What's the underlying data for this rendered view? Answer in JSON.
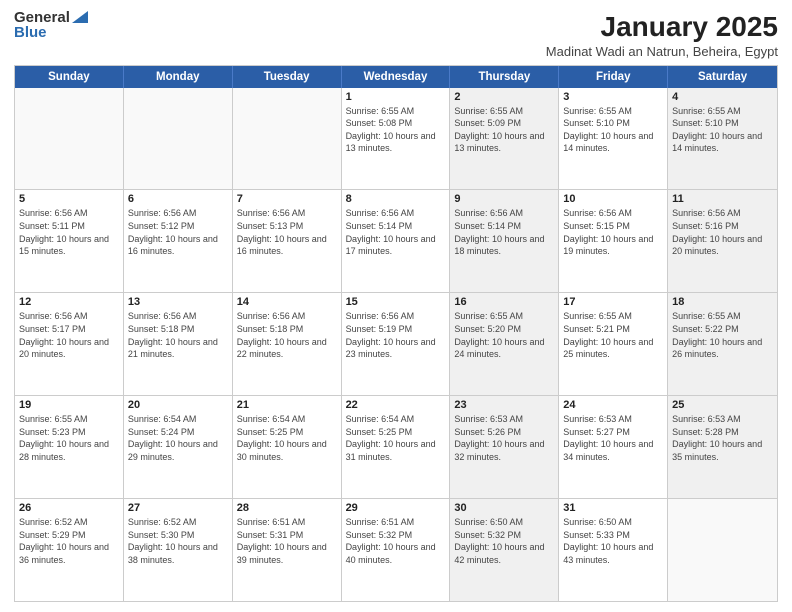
{
  "header": {
    "logo_general": "General",
    "logo_blue": "Blue",
    "title": "January 2025",
    "subtitle": "Madinat Wadi an Natrun, Beheira, Egypt"
  },
  "days": [
    "Sunday",
    "Monday",
    "Tuesday",
    "Wednesday",
    "Thursday",
    "Friday",
    "Saturday"
  ],
  "weeks": [
    [
      {
        "day": "",
        "sunrise": "",
        "sunset": "",
        "daylight": "",
        "shaded": false,
        "empty": true
      },
      {
        "day": "",
        "sunrise": "",
        "sunset": "",
        "daylight": "",
        "shaded": false,
        "empty": true
      },
      {
        "day": "",
        "sunrise": "",
        "sunset": "",
        "daylight": "",
        "shaded": false,
        "empty": true
      },
      {
        "day": "1",
        "sunrise": "Sunrise: 6:55 AM",
        "sunset": "Sunset: 5:08 PM",
        "daylight": "Daylight: 10 hours and 13 minutes.",
        "shaded": false,
        "empty": false
      },
      {
        "day": "2",
        "sunrise": "Sunrise: 6:55 AM",
        "sunset": "Sunset: 5:09 PM",
        "daylight": "Daylight: 10 hours and 13 minutes.",
        "shaded": true,
        "empty": false
      },
      {
        "day": "3",
        "sunrise": "Sunrise: 6:55 AM",
        "sunset": "Sunset: 5:10 PM",
        "daylight": "Daylight: 10 hours and 14 minutes.",
        "shaded": false,
        "empty": false
      },
      {
        "day": "4",
        "sunrise": "Sunrise: 6:55 AM",
        "sunset": "Sunset: 5:10 PM",
        "daylight": "Daylight: 10 hours and 14 minutes.",
        "shaded": true,
        "empty": false
      }
    ],
    [
      {
        "day": "5",
        "sunrise": "Sunrise: 6:56 AM",
        "sunset": "Sunset: 5:11 PM",
        "daylight": "Daylight: 10 hours and 15 minutes.",
        "shaded": false,
        "empty": false
      },
      {
        "day": "6",
        "sunrise": "Sunrise: 6:56 AM",
        "sunset": "Sunset: 5:12 PM",
        "daylight": "Daylight: 10 hours and 16 minutes.",
        "shaded": false,
        "empty": false
      },
      {
        "day": "7",
        "sunrise": "Sunrise: 6:56 AM",
        "sunset": "Sunset: 5:13 PM",
        "daylight": "Daylight: 10 hours and 16 minutes.",
        "shaded": false,
        "empty": false
      },
      {
        "day": "8",
        "sunrise": "Sunrise: 6:56 AM",
        "sunset": "Sunset: 5:14 PM",
        "daylight": "Daylight: 10 hours and 17 minutes.",
        "shaded": false,
        "empty": false
      },
      {
        "day": "9",
        "sunrise": "Sunrise: 6:56 AM",
        "sunset": "Sunset: 5:14 PM",
        "daylight": "Daylight: 10 hours and 18 minutes.",
        "shaded": true,
        "empty": false
      },
      {
        "day": "10",
        "sunrise": "Sunrise: 6:56 AM",
        "sunset": "Sunset: 5:15 PM",
        "daylight": "Daylight: 10 hours and 19 minutes.",
        "shaded": false,
        "empty": false
      },
      {
        "day": "11",
        "sunrise": "Sunrise: 6:56 AM",
        "sunset": "Sunset: 5:16 PM",
        "daylight": "Daylight: 10 hours and 20 minutes.",
        "shaded": true,
        "empty": false
      }
    ],
    [
      {
        "day": "12",
        "sunrise": "Sunrise: 6:56 AM",
        "sunset": "Sunset: 5:17 PM",
        "daylight": "Daylight: 10 hours and 20 minutes.",
        "shaded": false,
        "empty": false
      },
      {
        "day": "13",
        "sunrise": "Sunrise: 6:56 AM",
        "sunset": "Sunset: 5:18 PM",
        "daylight": "Daylight: 10 hours and 21 minutes.",
        "shaded": false,
        "empty": false
      },
      {
        "day": "14",
        "sunrise": "Sunrise: 6:56 AM",
        "sunset": "Sunset: 5:18 PM",
        "daylight": "Daylight: 10 hours and 22 minutes.",
        "shaded": false,
        "empty": false
      },
      {
        "day": "15",
        "sunrise": "Sunrise: 6:56 AM",
        "sunset": "Sunset: 5:19 PM",
        "daylight": "Daylight: 10 hours and 23 minutes.",
        "shaded": false,
        "empty": false
      },
      {
        "day": "16",
        "sunrise": "Sunrise: 6:55 AM",
        "sunset": "Sunset: 5:20 PM",
        "daylight": "Daylight: 10 hours and 24 minutes.",
        "shaded": true,
        "empty": false
      },
      {
        "day": "17",
        "sunrise": "Sunrise: 6:55 AM",
        "sunset": "Sunset: 5:21 PM",
        "daylight": "Daylight: 10 hours and 25 minutes.",
        "shaded": false,
        "empty": false
      },
      {
        "day": "18",
        "sunrise": "Sunrise: 6:55 AM",
        "sunset": "Sunset: 5:22 PM",
        "daylight": "Daylight: 10 hours and 26 minutes.",
        "shaded": true,
        "empty": false
      }
    ],
    [
      {
        "day": "19",
        "sunrise": "Sunrise: 6:55 AM",
        "sunset": "Sunset: 5:23 PM",
        "daylight": "Daylight: 10 hours and 28 minutes.",
        "shaded": false,
        "empty": false
      },
      {
        "day": "20",
        "sunrise": "Sunrise: 6:54 AM",
        "sunset": "Sunset: 5:24 PM",
        "daylight": "Daylight: 10 hours and 29 minutes.",
        "shaded": false,
        "empty": false
      },
      {
        "day": "21",
        "sunrise": "Sunrise: 6:54 AM",
        "sunset": "Sunset: 5:25 PM",
        "daylight": "Daylight: 10 hours and 30 minutes.",
        "shaded": false,
        "empty": false
      },
      {
        "day": "22",
        "sunrise": "Sunrise: 6:54 AM",
        "sunset": "Sunset: 5:25 PM",
        "daylight": "Daylight: 10 hours and 31 minutes.",
        "shaded": false,
        "empty": false
      },
      {
        "day": "23",
        "sunrise": "Sunrise: 6:53 AM",
        "sunset": "Sunset: 5:26 PM",
        "daylight": "Daylight: 10 hours and 32 minutes.",
        "shaded": true,
        "empty": false
      },
      {
        "day": "24",
        "sunrise": "Sunrise: 6:53 AM",
        "sunset": "Sunset: 5:27 PM",
        "daylight": "Daylight: 10 hours and 34 minutes.",
        "shaded": false,
        "empty": false
      },
      {
        "day": "25",
        "sunrise": "Sunrise: 6:53 AM",
        "sunset": "Sunset: 5:28 PM",
        "daylight": "Daylight: 10 hours and 35 minutes.",
        "shaded": true,
        "empty": false
      }
    ],
    [
      {
        "day": "26",
        "sunrise": "Sunrise: 6:52 AM",
        "sunset": "Sunset: 5:29 PM",
        "daylight": "Daylight: 10 hours and 36 minutes.",
        "shaded": false,
        "empty": false
      },
      {
        "day": "27",
        "sunrise": "Sunrise: 6:52 AM",
        "sunset": "Sunset: 5:30 PM",
        "daylight": "Daylight: 10 hours and 38 minutes.",
        "shaded": false,
        "empty": false
      },
      {
        "day": "28",
        "sunrise": "Sunrise: 6:51 AM",
        "sunset": "Sunset: 5:31 PM",
        "daylight": "Daylight: 10 hours and 39 minutes.",
        "shaded": false,
        "empty": false
      },
      {
        "day": "29",
        "sunrise": "Sunrise: 6:51 AM",
        "sunset": "Sunset: 5:32 PM",
        "daylight": "Daylight: 10 hours and 40 minutes.",
        "shaded": false,
        "empty": false
      },
      {
        "day": "30",
        "sunrise": "Sunrise: 6:50 AM",
        "sunset": "Sunset: 5:32 PM",
        "daylight": "Daylight: 10 hours and 42 minutes.",
        "shaded": true,
        "empty": false
      },
      {
        "day": "31",
        "sunrise": "Sunrise: 6:50 AM",
        "sunset": "Sunset: 5:33 PM",
        "daylight": "Daylight: 10 hours and 43 minutes.",
        "shaded": false,
        "empty": false
      },
      {
        "day": "",
        "sunrise": "",
        "sunset": "",
        "daylight": "",
        "shaded": true,
        "empty": true
      }
    ]
  ]
}
